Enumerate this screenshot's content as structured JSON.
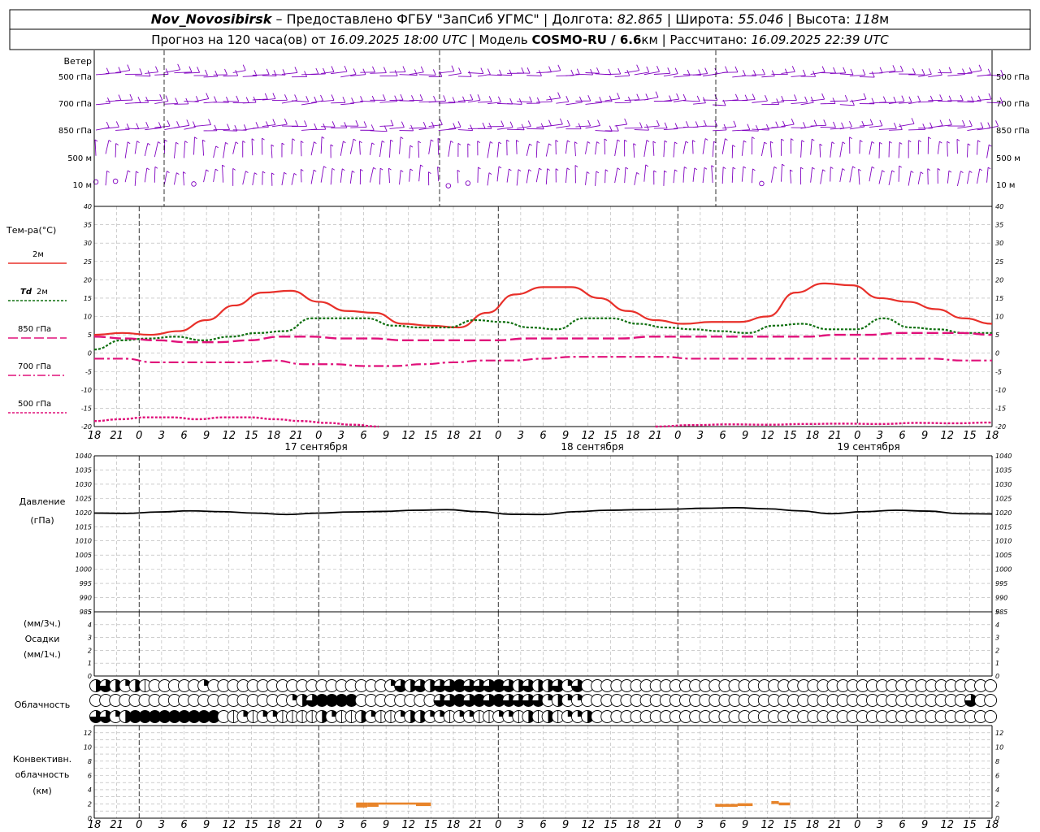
{
  "header": {
    "station": "Nov_Novosibirsk",
    "provided": " – Предоставлено ФГБУ \"ЗапСиб УГМС\" | Долгота: ",
    "lon": "82.865",
    "lat_label": " | Широта: ",
    "lat": "55.046",
    "alt_label": " | Высота: ",
    "alt": "118",
    "alt_unit": "м",
    "forecast_label": "Прогноз на 120 часа(ов) от ",
    "forecast_from": "16.09.2025 18:00 UTC",
    "model_label": " | Модель ",
    "model": "COSMO-RU / 6.6",
    "model_unit": "км",
    "calc_label": " | Рассчитано: ",
    "calc_time": "16.09.2025 22:39 UTC"
  },
  "labels": {
    "wind": "Ветер",
    "wind_levels": [
      "500 гПа",
      "700 гПа",
      "850 гПа",
      "500 м",
      "10  м"
    ],
    "temp_title": "Тем-ра(°С)",
    "temp_2m": "2м",
    "td_prefix": "Td",
    "td_2m": "2м",
    "t850": "850 гПа",
    "t700": "700 гПа",
    "t500": "500 гПа",
    "pressure_line1": "Давление",
    "pressure_line2": "(гПа)",
    "precip_line1": "(мм/3ч.)",
    "precip_line2": "Осадки",
    "precip_line3": "(мм/1ч.)",
    "cloud": "Облачность",
    "conv_line1": "Конвективн.",
    "conv_line2": "облачность",
    "conv_line3": "(км)",
    "days": [
      "17 сентября",
      "18 сентября",
      "19 сентября"
    ]
  },
  "colors": {
    "wind": "#8000c0",
    "t2m": "#e8302a",
    "td": "#107010",
    "pink": "#e0107a",
    "pressure": "#000000",
    "conv": "#e8842a",
    "grid": "#b0b0b0"
  },
  "chart_data": [
    {
      "type": "line",
      "title": "Тем-ра(°С)",
      "ylim": [
        -20,
        40
      ],
      "x_hours": [
        0,
        3,
        6,
        9,
        12,
        15,
        18,
        21,
        24,
        27,
        30,
        33,
        36,
        39,
        42,
        45,
        48,
        51,
        54,
        57,
        60,
        63,
        66,
        69,
        72,
        75,
        78,
        81,
        84,
        87,
        90,
        93,
        96,
        99,
        102,
        105,
        108,
        111,
        114,
        117,
        120
      ],
      "xticklabels": [
        "18",
        "21",
        "0",
        "3",
        "6",
        "9",
        "12",
        "15",
        "18",
        "21",
        "0",
        "3",
        "6",
        "9",
        "12",
        "15",
        "18",
        "21",
        "0",
        "3",
        "6",
        "9",
        "12",
        "15",
        "18",
        "21",
        "0",
        "3",
        "6",
        "9",
        "12",
        "15",
        "18",
        "21",
        "0",
        "3",
        "6",
        "9",
        "12",
        "15",
        "18",
        "21",
        "0"
      ],
      "series": [
        {
          "name": "2м",
          "values": [
            5,
            5.5,
            5,
            6,
            9,
            13,
            16.5,
            17,
            14,
            11.5,
            11,
            8,
            7.5,
            7,
            11,
            16,
            18,
            18,
            15,
            11.5,
            9,
            8,
            8.5,
            8.5,
            10,
            16.5,
            19,
            18.5,
            15,
            14,
            12,
            9.5,
            8
          ]
        },
        {
          "name": "Td 2м",
          "values": [
            1,
            3.5,
            4,
            4.5,
            3.5,
            4.5,
            5.5,
            6,
            9.5,
            9.5,
            9.5,
            7.5,
            7,
            7,
            9,
            8.5,
            7,
            6.5,
            9.5,
            9.5,
            8,
            7,
            6.5,
            6,
            5.5,
            7.5,
            8,
            6.5,
            6.5,
            9.5,
            7,
            6.5,
            5.5,
            5.5
          ]
        },
        {
          "name": "850 гПа",
          "values": [
            4.5,
            4,
            3.5,
            3,
            3,
            3.5,
            4.5,
            4.5,
            4,
            4,
            3.5,
            3.5,
            3.5,
            3.5,
            4,
            4,
            4,
            4,
            4.5,
            4.5,
            4.5,
            4.5,
            4.5,
            4.5,
            5,
            5,
            5.5,
            5.5,
            5.5,
            5
          ]
        },
        {
          "name": "700 гПа",
          "values": [
            -1.5,
            -1.5,
            -2.5,
            -2.5,
            -2.5,
            -2.5,
            -2,
            -3,
            -3,
            -3.5,
            -3.5,
            -3,
            -2.5,
            -2,
            -2,
            -1.5,
            -1,
            -1,
            -1,
            -1,
            -1.5,
            -1.5,
            -1.5,
            -1.5,
            -1.5,
            -1.5,
            -1.5,
            -1.5,
            -1.5,
            -2,
            -2
          ]
        },
        {
          "name": "500 гПа",
          "values": [
            -18.5,
            -18,
            -17.5,
            -17.5,
            -18,
            -17.5,
            -17.5,
            -18,
            -18.5,
            -19,
            -19.5,
            -20
          ]
        }
      ]
    },
    {
      "type": "line",
      "title": "Давление (гПа)",
      "ylim": [
        985,
        1040
      ],
      "series": [
        {
          "name": "Давление",
          "values": [
            1019.8,
            1019.7,
            1020.2,
            1020.6,
            1020.3,
            1019.8,
            1019.3,
            1019.8,
            1020.2,
            1020.4,
            1020.8,
            1021,
            1020.3,
            1019.4,
            1019.3,
            1020.3,
            1020.8,
            1021,
            1021.2,
            1021.5,
            1021.7,
            1021.3,
            1020.6,
            1019.6,
            1020.3,
            1020.8,
            1020.5,
            1019.6,
            1019.5
          ]
        }
      ]
    },
    {
      "type": "bar",
      "title": "Осадки",
      "ylim": [
        0,
        5
      ],
      "series": [
        {
          "name": "Осадки",
          "values": []
        }
      ]
    },
    {
      "type": "bar",
      "title": "Конвективн. облачность (км)",
      "ylim": [
        0,
        13
      ],
      "segments": [
        {
          "from_hour": 35,
          "to_hour": 36.5,
          "bottom": 1.5,
          "top": 2.2
        },
        {
          "from_hour": 36.5,
          "to_hour": 38,
          "bottom": 1.6,
          "top": 2.2
        },
        {
          "from_hour": 38,
          "to_hour": 43,
          "bottom": 1.9,
          "top": 2.2
        },
        {
          "from_hour": 43,
          "to_hour": 45,
          "bottom": 1.7,
          "top": 2.2
        },
        {
          "from_hour": 83,
          "to_hour": 86,
          "bottom": 1.6,
          "top": 2.0
        },
        {
          "from_hour": 86,
          "to_hour": 88,
          "bottom": 1.7,
          "top": 2.1
        },
        {
          "from_hour": 90.5,
          "to_hour": 91.5,
          "bottom": 2.0,
          "top": 2.4
        },
        {
          "from_hour": 91.5,
          "to_hour": 93,
          "bottom": 1.8,
          "top": 2.2
        }
      ]
    }
  ]
}
